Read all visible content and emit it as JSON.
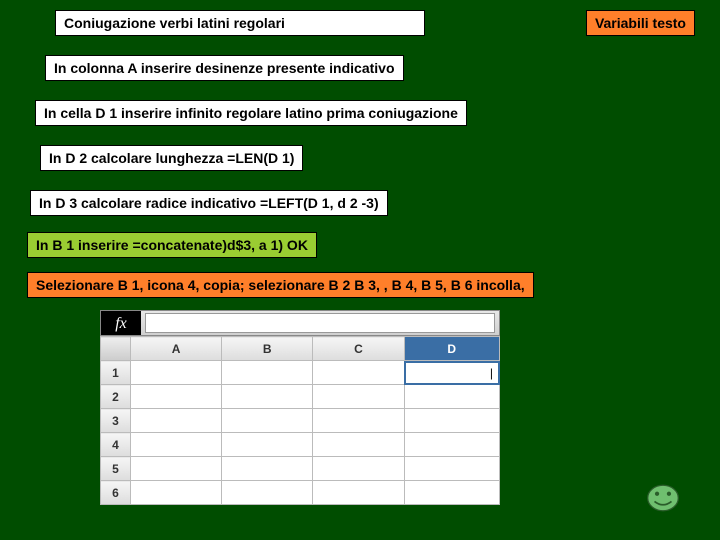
{
  "title": "Coniugazione verbi latini regolari",
  "badge": "Variabili testo",
  "steps": {
    "s1": "In colonna A inserire desinenze presente indicativo",
    "s2": "In cella D 1 inserire infinito regolare latino prima coniugazione",
    "s3": "In D 2 calcolare lunghezza =LEN(D 1)",
    "s4": "In D 3 calcolare radice indicativo =LEFT(D 1, d 2 -3)",
    "s5": "In B 1 inserire =concatenate)d$3, a 1) OK",
    "s6": "Selezionare B 1, icona 4, copia; selezionare B 2 B 3, , B 4, B 5, B 6 incolla,"
  },
  "sheet": {
    "fx": "fx",
    "cols": [
      "A",
      "B",
      "C",
      "D"
    ],
    "rows": [
      "1",
      "2",
      "3",
      "4",
      "5",
      "6"
    ],
    "selectedCol": "D",
    "cursor": "|"
  }
}
